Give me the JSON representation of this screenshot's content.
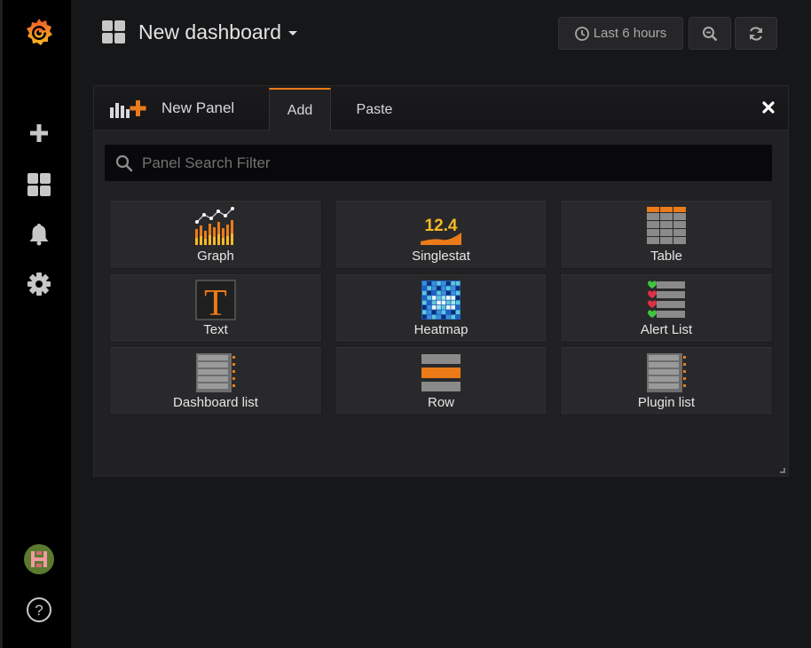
{
  "sidebar": {
    "logo_icon": "grafana-logo-icon",
    "items": [
      {
        "icon": "plus-icon",
        "name": "create"
      },
      {
        "icon": "dashboards-icon",
        "name": "dashboards"
      },
      {
        "icon": "bell-icon",
        "name": "alerting"
      },
      {
        "icon": "gear-icon",
        "name": "configuration"
      }
    ],
    "avatar_icon": "user-avatar-icon",
    "help_icon": "help-icon"
  },
  "navbar": {
    "dashboard_title": "New dashboard",
    "time_range": "Last 6 hours",
    "zoom_icon": "zoom-out-icon",
    "refresh_icon": "refresh-icon"
  },
  "panel": {
    "header_title": "New Panel",
    "tabs": [
      {
        "label": "Add",
        "active": true
      },
      {
        "label": "Paste",
        "active": false
      }
    ],
    "search_placeholder": "Panel Search Filter",
    "cards": [
      {
        "label": "Graph",
        "icon": "graph-icon"
      },
      {
        "label": "Singlestat",
        "icon": "singlestat-icon",
        "icon_text": "12.4"
      },
      {
        "label": "Table",
        "icon": "table-icon"
      },
      {
        "label": "Text",
        "icon": "text-icon",
        "icon_text": "T"
      },
      {
        "label": "Heatmap",
        "icon": "heatmap-icon"
      },
      {
        "label": "Alert List",
        "icon": "alert-list-icon"
      },
      {
        "label": "Dashboard list",
        "icon": "dashboard-list-icon"
      },
      {
        "label": "Row",
        "icon": "row-icon"
      },
      {
        "label": "Plugin list",
        "icon": "plugin-list-icon"
      }
    ]
  },
  "colors": {
    "accent": "#eb7b18",
    "background": "#161719",
    "sidebar": "#000000",
    "panel": "#212124",
    "card": "#29292b"
  }
}
